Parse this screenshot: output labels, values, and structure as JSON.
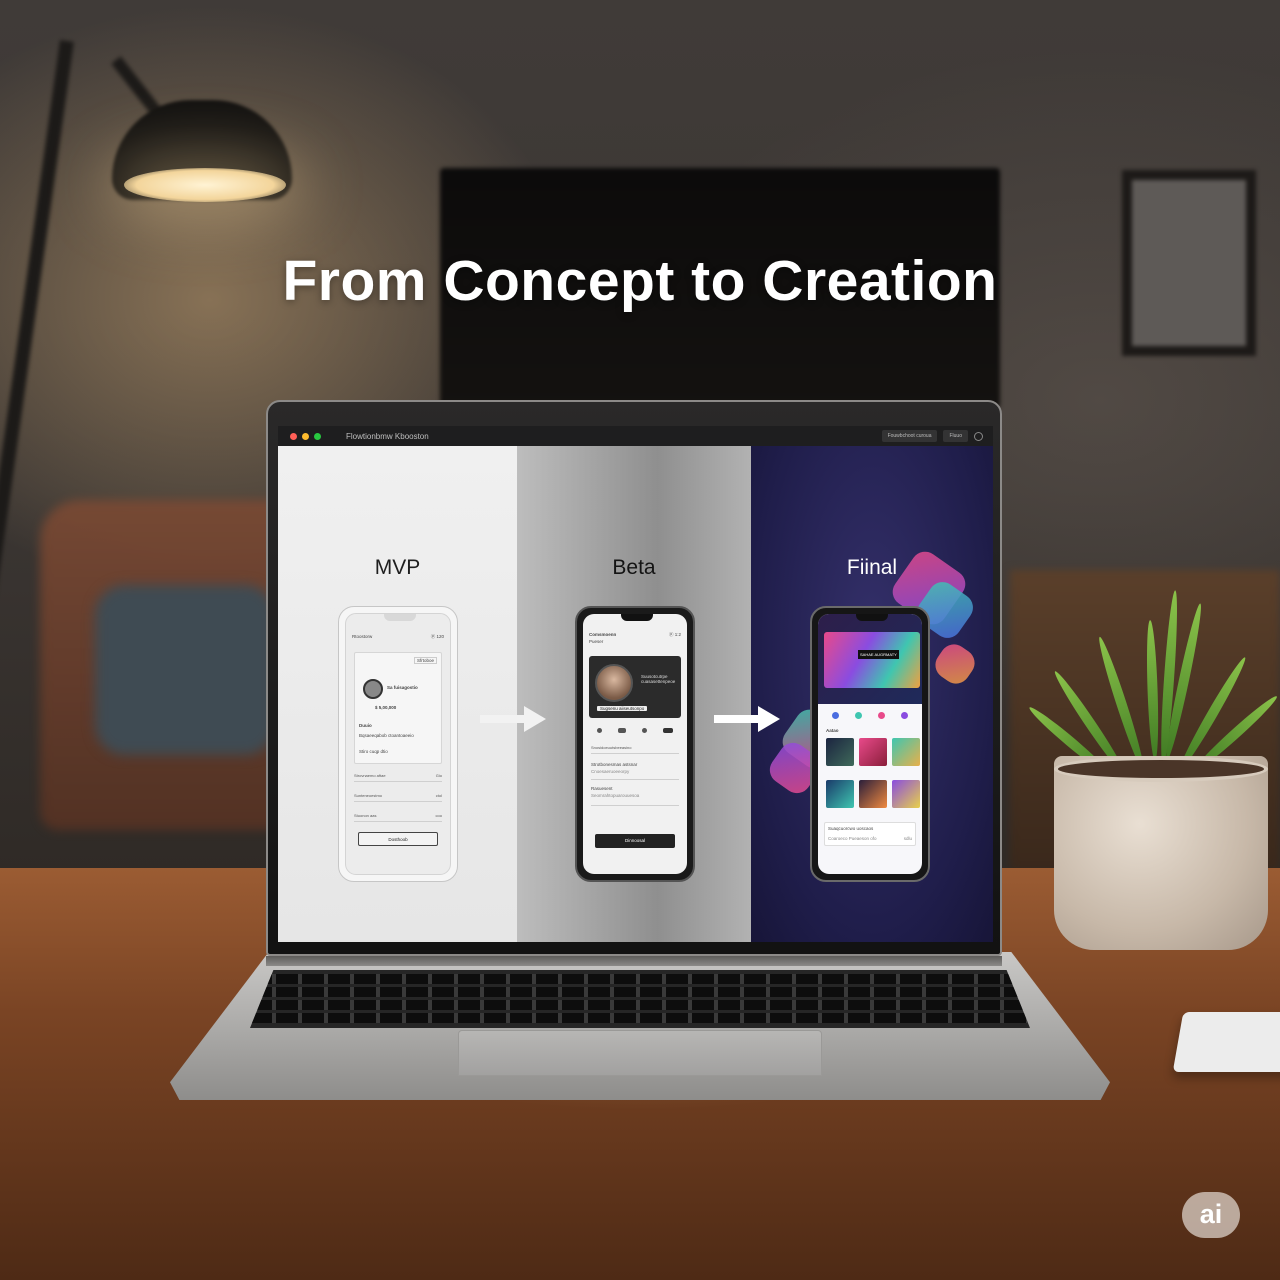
{
  "headline": "From Concept to Creation",
  "browser": {
    "title": "Flowtionbmw Kbooston",
    "buttons": [
      "Fouwbchoot curoua",
      "Fluuo"
    ],
    "traffic_lights": [
      "#ff5f57",
      "#febc2e",
      "#28c840"
    ]
  },
  "stages": [
    {
      "label": "MVP",
      "phone": {
        "header": "Rtoostorw",
        "header_right": "ⓟ 120",
        "badge": "Sfrtoboe",
        "profile_name": "Sa fuisagostio",
        "price": "$ 5,00,000",
        "section": "Duuio",
        "section_sub": "Bqsaeeqabob ctoantoaeeio",
        "meta": "Stiro cuqp dtio",
        "rows": [
          {
            "label": "Strovnaemo aftae",
            "value": "Gio"
          },
          {
            "label": "Sunteneoestmo",
            "value": "ctol"
          },
          {
            "label": "Stuonon aas",
            "value": "coo"
          }
        ],
        "button": "Dosthoob"
      }
    },
    {
      "label": "Beta",
      "phone": {
        "header": "Comsmoenn",
        "header_sub": "Pueser",
        "header_right": "ⓟ 1:2",
        "card_text": "Suusotcutrpe cuasasettenpeoe",
        "card_sub": "Sugsenu aiiseutsonpo",
        "rows": [
          {
            "label": "Snosidoeuutsbeeasino"
          },
          {
            "label": "Strotbonesmas astsnar",
            "sub": "Cnoesaeruoeeorpy"
          },
          {
            "label": "Rasuesent",
            "sub": "Seomrahtopuarouuesoa"
          }
        ],
        "button": "Dinnoosal"
      }
    },
    {
      "label": "Fiinal",
      "phone": {
        "hero_text": "SAHAE AUGRMATY",
        "section": "Aatao",
        "footer_label": "Suaqcuorcwo uoscaos",
        "footer_sub": "Coaroeco Pueaeson ofo",
        "footer_right": "sdlu"
      }
    }
  ],
  "badge": "ai",
  "colors": {
    "final_bg": "#1f1d4a",
    "beta_button": "#222222",
    "accent_pink": "#e84a8a",
    "accent_teal": "#3fc6b0",
    "accent_purple": "#8a4ce0"
  }
}
